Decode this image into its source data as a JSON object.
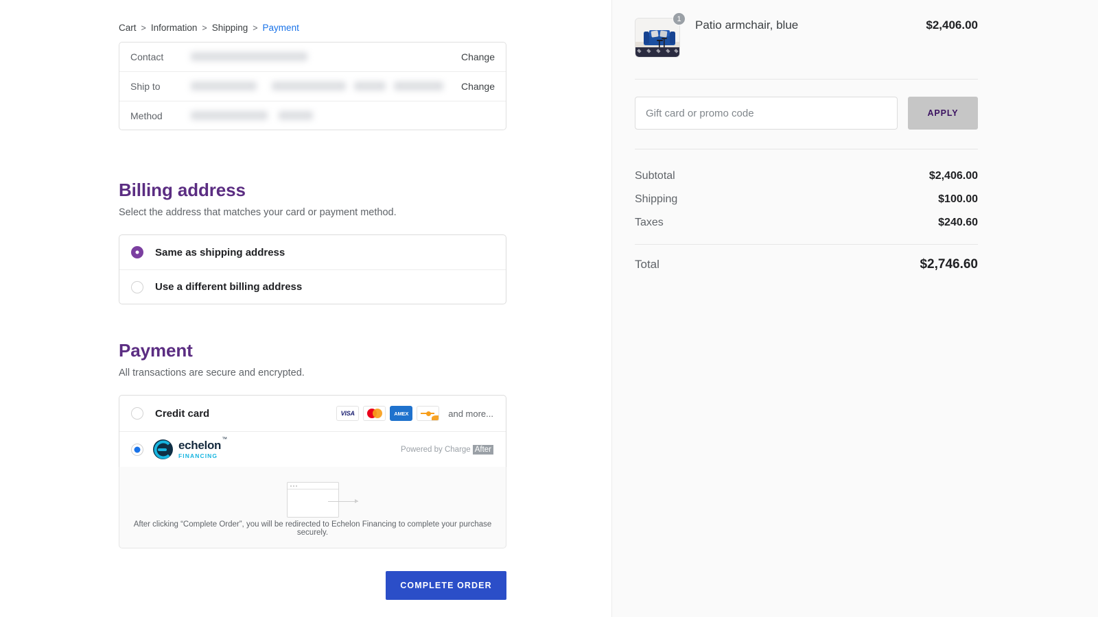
{
  "breadcrumb": {
    "items": [
      {
        "label": "Cart",
        "active": false
      },
      {
        "label": "Information",
        "active": false
      },
      {
        "label": "Shipping",
        "active": false
      },
      {
        "label": "Payment",
        "active": true
      }
    ],
    "separator": ">"
  },
  "order_summary_card": {
    "rows": [
      {
        "label": "Contact",
        "value_redacted": true,
        "action": "Change"
      },
      {
        "label": "Ship to",
        "value_redacted": true,
        "action": "Change"
      },
      {
        "label": "Method",
        "value_redacted": true,
        "action": ""
      }
    ]
  },
  "billing": {
    "title": "Billing address",
    "subtitle": "Select the address that matches your card or payment method.",
    "options": [
      {
        "label": "Same as shipping address",
        "selected": true
      },
      {
        "label": "Use a different billing address",
        "selected": false
      }
    ]
  },
  "payment": {
    "title": "Payment",
    "subtitle": "All transactions are secure and encrypted.",
    "credit_card": {
      "label": "Credit card",
      "selected": false,
      "brands": [
        "visa",
        "mastercard",
        "amex",
        "discover"
      ],
      "visa_text": "VISA",
      "amex_text": "AMEX",
      "more_text": "and more..."
    },
    "echelon": {
      "selected": true,
      "brand_name": "echelon",
      "brand_tagline": "FINANCING",
      "trademark": "™",
      "powered_prefix": "Powered by Charge",
      "powered_badge": "After"
    },
    "redirect_notice": "After clicking “Complete Order”, you will be redirected to Echelon Financing to complete your purchase securely."
  },
  "cta": {
    "label": "COMPLETE ORDER"
  },
  "cart": {
    "product": {
      "name": "Patio armchair, blue",
      "quantity": "1",
      "price": "$2,406.00"
    },
    "promo": {
      "placeholder": "Gift card or promo code",
      "value": "",
      "apply_label": "APPLY"
    },
    "totals": [
      {
        "label": "Subtotal",
        "value": "$2,406.00"
      },
      {
        "label": "Shipping",
        "value": "$100.00"
      },
      {
        "label": "Taxes",
        "value": "$240.60"
      }
    ],
    "grand_total": {
      "label": "Total",
      "value": "$2,746.60"
    }
  },
  "colors": {
    "heading_purple": "#5b2d82",
    "link_blue": "#1a73e8",
    "cta_blue": "#2b4ec8",
    "radio_purple": "#7b3fa0",
    "radio_blue": "#1a73e8",
    "apply_gray": "#c6c6c6",
    "panel_bg": "#fafafa"
  }
}
